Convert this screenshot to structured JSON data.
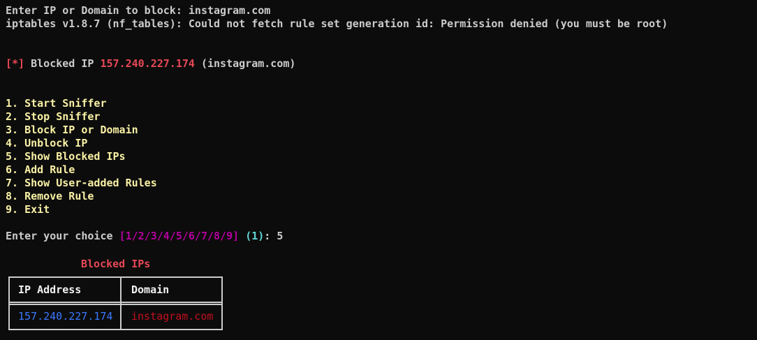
{
  "prompt": {
    "label": "Enter IP or Domain to block: ",
    "value": "instagram.com"
  },
  "error_line": "iptables v1.8.7 (nf_tables): Could not fetch rule set generation id: Permission denied (you must be root)",
  "blocked_message": {
    "marker": "[*]",
    "text": " Blocked IP ",
    "ip": "157.240.227.174",
    "domain": " (instagram.com)"
  },
  "menu": [
    "1. Start Sniffer",
    "2. Stop Sniffer",
    "3. Block IP or Domain",
    "4. Unblock IP",
    "5. Show Blocked IPs",
    "6. Add Rule",
    "7. Show User-added Rules",
    "8. Remove Rule",
    "9. Exit"
  ],
  "choice": {
    "label": "Enter your choice ",
    "options": "[1/2/3/4/5/6/7/8/9]",
    "default": "(1)",
    "separator": ": ",
    "value": "5"
  },
  "table": {
    "title": "Blocked IPs",
    "headers": [
      "IP Address",
      "Domain"
    ],
    "rows": [
      [
        "157.240.227.174",
        "instagram.com"
      ]
    ]
  },
  "colors": {
    "background": "#0c0c0c",
    "foreground": "#cccccc",
    "red": "#e74856",
    "menu_yellow": "#f9f1a5",
    "magenta": "#b4009e",
    "cyan": "#61d6d6",
    "ip_blue": "#3b78ff",
    "domain_red": "#c50f1f"
  }
}
